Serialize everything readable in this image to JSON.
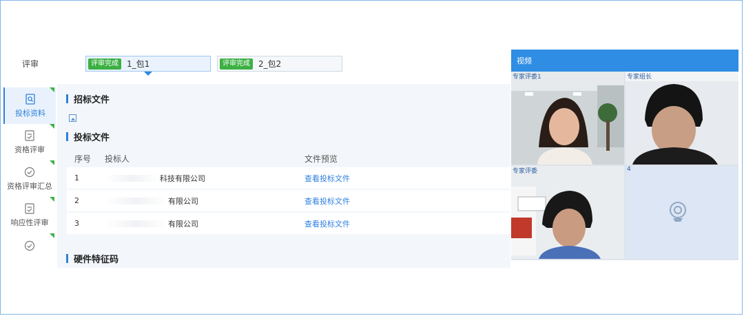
{
  "review": {
    "label": "评审",
    "packages": [
      {
        "status": "评审完成",
        "name": "1_包1",
        "active": true
      },
      {
        "status": "评审完成",
        "name": "2_包2",
        "active": false
      }
    ]
  },
  "sidebar": {
    "items": [
      {
        "label": "投标资料",
        "icon": "search-doc-icon",
        "active": true
      },
      {
        "label": "资格评审",
        "icon": "edit-doc-icon"
      },
      {
        "label": "资格评审汇总",
        "icon": "check-circle-icon"
      },
      {
        "label": "响应性评审",
        "icon": "edit-doc-icon"
      },
      {
        "label": "",
        "icon": "check-circle-icon"
      }
    ]
  },
  "sections": {
    "tender_docs": "招标文件",
    "bid_docs": "投标文件",
    "hardware_code": "硬件特征码"
  },
  "table": {
    "headers": [
      "序号",
      "投标人",
      "文件预览"
    ],
    "rows": [
      {
        "no": "1",
        "bidder": "科技有限公司",
        "action": "查看投标文件"
      },
      {
        "no": "2",
        "bidder": "有限公司",
        "action": "查看投标文件"
      },
      {
        "no": "3",
        "bidder": "有限公司",
        "action": "查看投标文件"
      }
    ]
  },
  "video": {
    "title": "视频",
    "tiles": [
      {
        "label": "专家评委1"
      },
      {
        "label": "专家组长"
      },
      {
        "label": "专家评委"
      },
      {
        "label": "4"
      }
    ],
    "colors": {
      "header": "#2f8de4",
      "empty_tile": "#dce6f4"
    }
  }
}
